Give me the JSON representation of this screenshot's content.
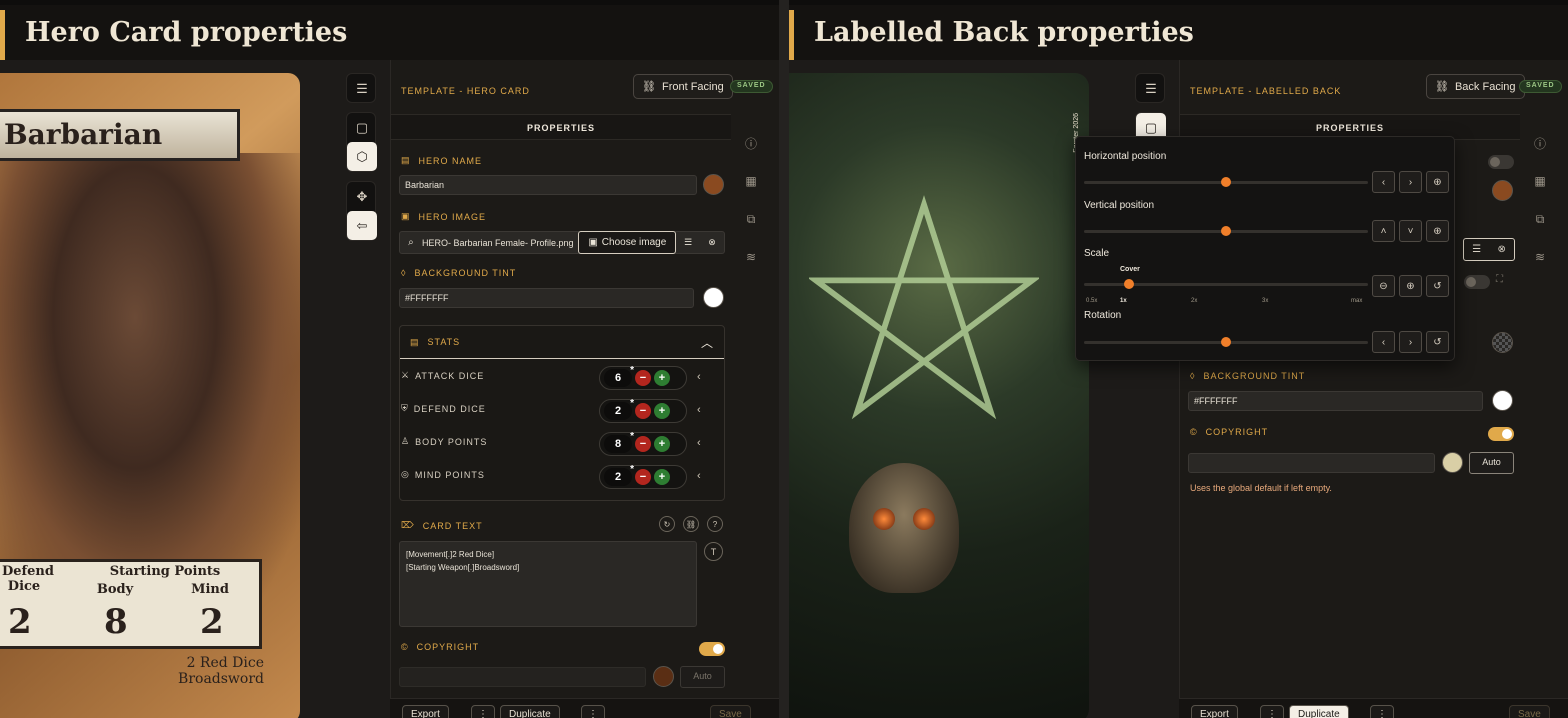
{
  "left": {
    "heading": "Hero Card properties",
    "card": {
      "name": "Barbarian",
      "table_defend": "Defend",
      "table_dice": "Dice",
      "table_starting": "Starting Points",
      "table_body": "Body",
      "table_mind": "Mind",
      "val_defend": "2",
      "val_body": "8",
      "val_mind": "2",
      "line1": "2 Red Dice",
      "line2": "Broadsword"
    },
    "template_label": "TEMPLATE - HERO CARD",
    "facing_label": "Front Facing",
    "saved_label": "SAVED",
    "properties_title": "PROPERTIES",
    "hero_name_label": "HERO NAME",
    "hero_name_value": "Barbarian",
    "hero_name_color": "#8a4a20",
    "hero_image_label": "HERO IMAGE",
    "hero_image_value": "HERO- Barbarian Female- Profile.png",
    "choose_image_label": "Choose image",
    "bg_tint_label": "BACKGROUND TINT",
    "bg_tint_value": "#FFFFFFF",
    "stats_label": "STATS",
    "stats": [
      {
        "label": "ATTACK DICE",
        "value": "6",
        "icon": "swords-icon"
      },
      {
        "label": "DEFEND DICE",
        "value": "2",
        "icon": "shield-icon"
      },
      {
        "label": "BODY POINTS",
        "value": "8",
        "icon": "person-icon"
      },
      {
        "label": "MIND POINTS",
        "value": "2",
        "icon": "mind-icon"
      }
    ],
    "card_text_label": "CARD TEXT",
    "card_text_value": "[Movement[.]2 Red Dice]\n[Starting Weapon[.]Broadsword]",
    "copyright_label": "COPYRIGHT",
    "copyright_enabled": true,
    "copyright_placeholder": "",
    "auto_label": "Auto",
    "export_label": "Export",
    "duplicate_label": "Duplicate",
    "save_label": "Save"
  },
  "right": {
    "heading": "Labelled Back properties",
    "vertical_credit": "Forster 2026",
    "template_label": "TEMPLATE - LABELLED BACK",
    "facing_label": "Back Facing",
    "saved_label": "SAVED",
    "properties_title": "PROPERTIES",
    "popup": {
      "horizontal_label": "Horizontal position",
      "horizontal_value": 0.5,
      "vertical_label": "Vertical position",
      "vertical_value": 0.5,
      "scale_label": "Scale",
      "scale_bubble": "Cover",
      "scale_value": 0.16,
      "scale_ticks": [
        "0.5x",
        "1x",
        "2x",
        "3x",
        "max"
      ],
      "rotation_label": "Rotation",
      "rotation_value": 0.5
    },
    "bg_tint_label": "BACKGROUND TINT",
    "bg_tint_value": "#FFFFFFF",
    "copyright_label": "COPYRIGHT",
    "copyright_enabled": true,
    "auto_label": "Auto",
    "copyright_hint": "Uses the global default if left empty.",
    "export_label": "Export",
    "duplicate_label": "Duplicate",
    "save_label": "Save"
  },
  "colors": {
    "accent": "#e0a94a",
    "slider_knob": "#f07f2a",
    "saved_green": "#9cc785"
  }
}
